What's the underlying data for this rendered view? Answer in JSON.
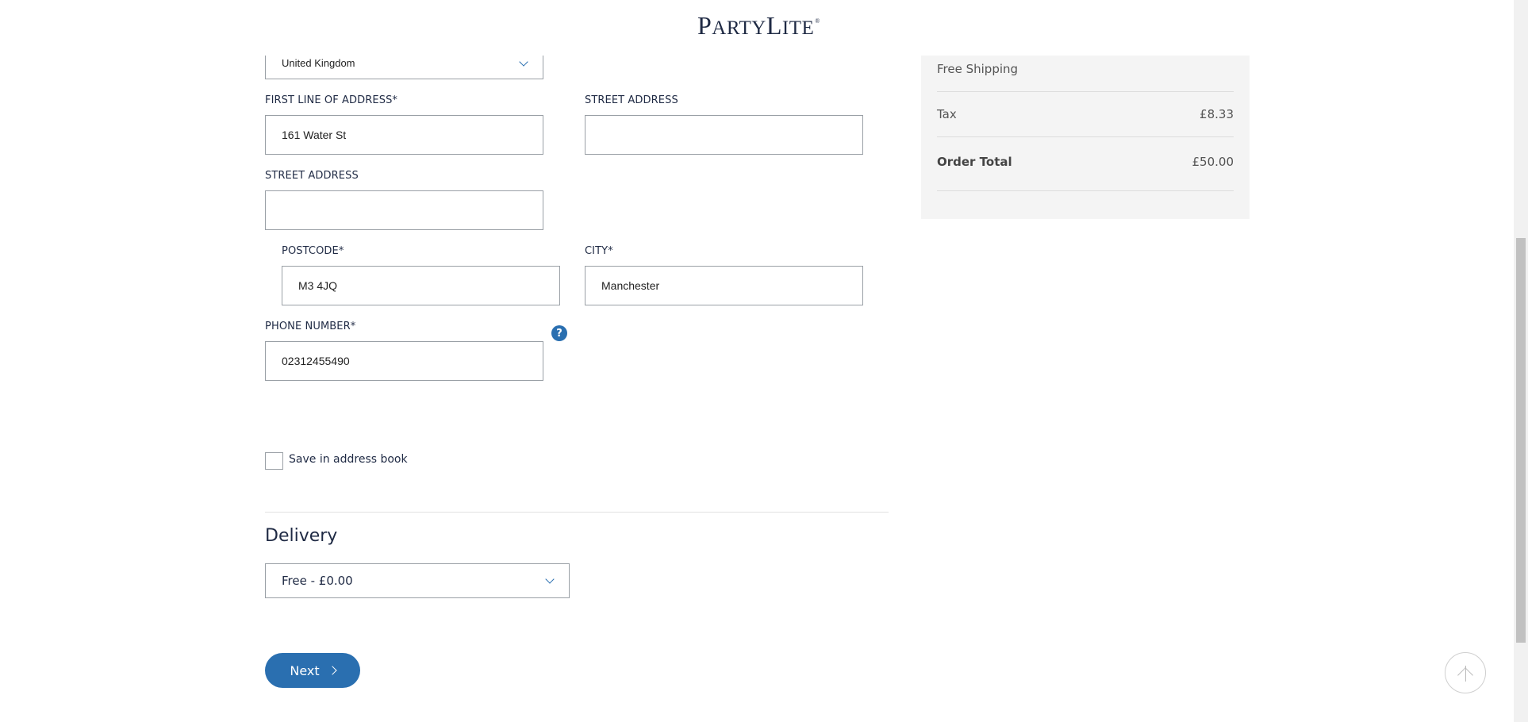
{
  "header": {
    "logo_text_big": "P",
    "logo_text_rest": "ARTY",
    "logo_text_big2": "L",
    "logo_text_rest2": "ITE",
    "logo_mark": "®"
  },
  "form": {
    "country": {
      "value": "United Kingdom"
    },
    "address_line1": {
      "label": "FIRST LINE OF ADDRESS*",
      "value": "161 Water St"
    },
    "street_address_2": {
      "label": "STREET ADDRESS",
      "value": ""
    },
    "street_address_3": {
      "label": "STREET ADDRESS",
      "value": ""
    },
    "postcode": {
      "label": "POSTCODE*",
      "value": "M3 4JQ"
    },
    "city": {
      "label": "CITY*",
      "value": "Manchester"
    },
    "phone": {
      "label": "PHONE NUMBER*",
      "value": "02312455490"
    },
    "help_symbol": "?",
    "save_address_label": "Save in address book"
  },
  "delivery": {
    "title": "Delivery",
    "selected_option": "Free - £0.00"
  },
  "next_button": {
    "label": "Next"
  },
  "summary": {
    "shipping_label": "Free Shipping",
    "tax_label": "Tax",
    "tax_value": "£8.33",
    "total_label": "Order Total",
    "total_value": "£50.00"
  },
  "icons": {
    "chevron": "chevron-down-icon",
    "help": "question-icon",
    "next": "chevron-right-icon",
    "to_top": "arrow-up-icon"
  },
  "colors": {
    "accent": "#2a6fb0",
    "text": "#1f2a44",
    "summary_bg": "#f4f4f4"
  }
}
